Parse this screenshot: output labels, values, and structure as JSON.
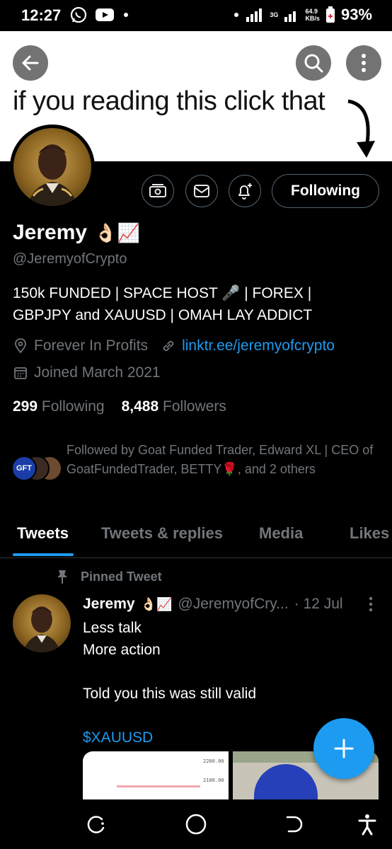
{
  "status_bar": {
    "time": "12:27",
    "network_small_top": "64.9",
    "network_small_bottom": "KB/s",
    "network_gen": "3G",
    "battery": "93%"
  },
  "banner": {
    "text": "if you reading this click that"
  },
  "profile": {
    "follow_label": "Following",
    "name": "Jeremy",
    "name_emojis": "👌🏻📈",
    "handle": "@JeremyofCrypto",
    "bio_line1": "150k FUNDED | SPACE HOST 🎤 | FOREX |",
    "bio_line2": "GBPJPY and XAUUSD | OMAH LAY ADDICT",
    "location": "Forever In Profits",
    "website": "linktr.ee/jeremyofcrypto",
    "joined": "Joined March 2021",
    "following_count": "299",
    "following_label": "Following",
    "followers_count": "8,488",
    "followers_label": "Followers",
    "followed_by": "Followed by Goat Funded Trader, Edward XL | CEO of GoatFundedTrader, BETTY🌹, and 2 others",
    "mini_avatar_badge": "GFT"
  },
  "tabs": [
    {
      "label": "Tweets"
    },
    {
      "label": "Tweets & replies"
    },
    {
      "label": "Media"
    },
    {
      "label": "Likes"
    }
  ],
  "tweet": {
    "pinned_label": "Pinned Tweet",
    "author_name": "Jeremy",
    "author_emojis": "👌🏻📈",
    "author_handle": "@JeremyofCry...",
    "date": "· 12 Jul",
    "line1": "Less talk",
    "line2": "More action",
    "line3": "Told you this was still valid",
    "cashtag": "$XAUUSD",
    "chart_tick1": "2200.00",
    "chart_tick2": "2100.00"
  },
  "colors": {
    "accent": "#1d9bf0",
    "secondary_text": "#71767b",
    "border": "#536471"
  }
}
